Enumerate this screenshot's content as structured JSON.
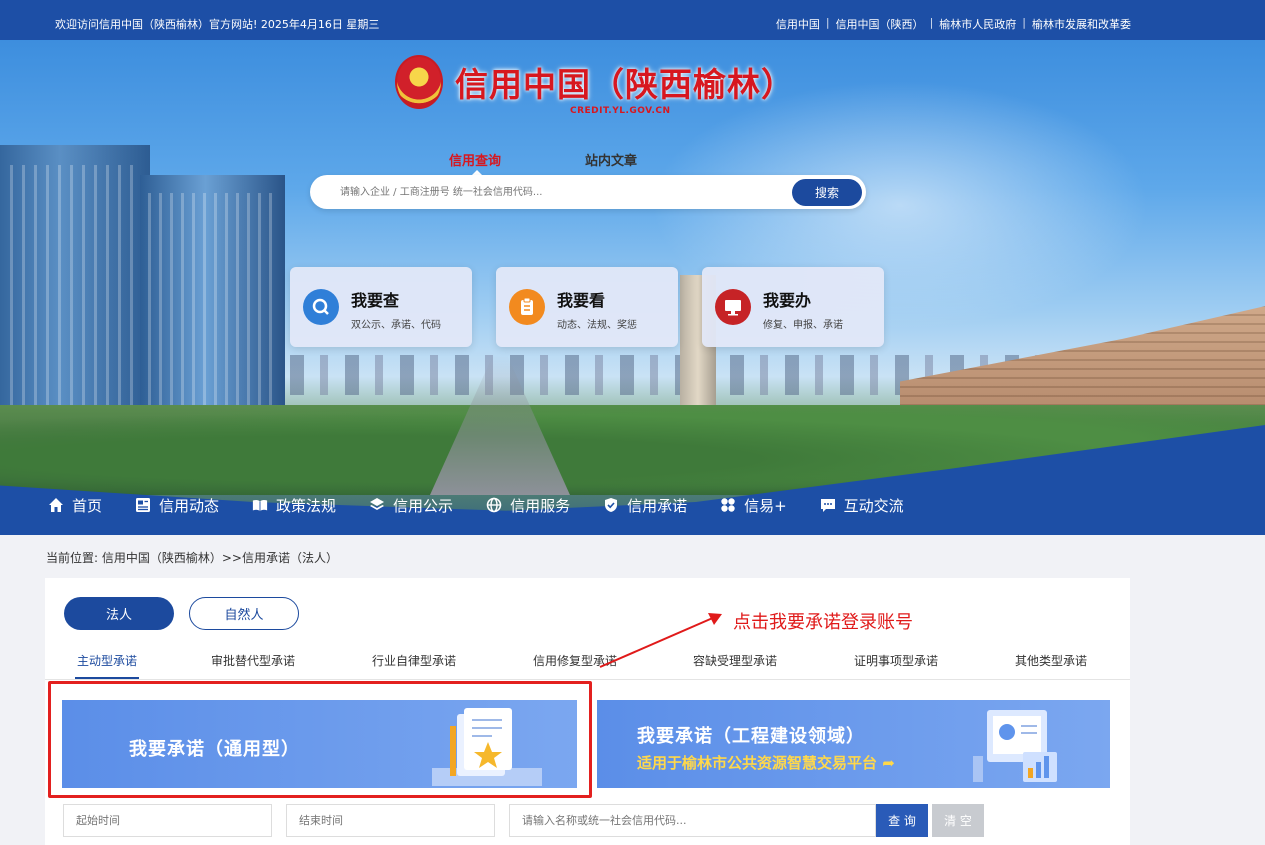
{
  "topbar": {
    "welcome": "欢迎访问信用中国（陕西榆林）官方网站!  2025年4月16日 星期三",
    "links": [
      "信用中国",
      "信用中国（陕西）",
      "榆林市人民政府",
      "榆林市发展和改革委"
    ]
  },
  "header": {
    "site_title": "信用中国（陕西榆林）",
    "site_domain": "CREDIT.YL.GOV.CN"
  },
  "search": {
    "tabs": [
      "信用查询",
      "站内文章"
    ],
    "placeholder": "请输入企业 / 工商注册号 统一社会信用代码...",
    "button_label": "搜索"
  },
  "quick_cards": [
    {
      "title": "我要查",
      "desc": "双公示、承诺、代码",
      "icon": "search-icon",
      "color": "#2f7fd8"
    },
    {
      "title": "我要看",
      "desc": "动态、法规、奖惩",
      "icon": "clipboard-icon",
      "color": "#f28a1f"
    },
    {
      "title": "我要办",
      "desc": "修复、申报、承诺",
      "icon": "monitor-icon",
      "color": "#c62326"
    }
  ],
  "nav": [
    {
      "label": "首页",
      "icon": "home-icon"
    },
    {
      "label": "信用动态",
      "icon": "news-icon"
    },
    {
      "label": "政策法规",
      "icon": "book-icon"
    },
    {
      "label": "信用公示",
      "icon": "layers-icon"
    },
    {
      "label": "信用服务",
      "icon": "globe-icon"
    },
    {
      "label": "信用承诺",
      "icon": "shield-icon"
    },
    {
      "label": "信易+",
      "icon": "grid-icon"
    },
    {
      "label": "互动交流",
      "icon": "chat-icon"
    }
  ],
  "breadcrumb": "当前位置:  信用中国（陕西榆林）>>信用承诺（法人）",
  "type_toggle": {
    "active": "法人",
    "inactive": "自然人"
  },
  "subtabs": [
    "主动型承诺",
    "审批替代型承诺",
    "行业自律型承诺",
    "信用修复型承诺",
    "容缺受理型承诺",
    "证明事项型承诺",
    "其他类型承诺"
  ],
  "annotation": "点击我要承诺登录账号",
  "cards": {
    "general_title": "我要承诺（通用型）",
    "engineering_title": "我要承诺（工程建设领域）",
    "engineering_sub": "适用于榆林市公共资源智慧交易平台"
  },
  "filters": {
    "start_placeholder": "起始时间",
    "end_placeholder": "结束时间",
    "name_placeholder": "请输入名称或统一社会信用代码...",
    "query_label": "查 询",
    "clear_label": "清 空"
  },
  "colors": {
    "brand_blue": "#1d4fa6",
    "title_red": "#d7171f",
    "annotation_red": "#e01a1a"
  }
}
